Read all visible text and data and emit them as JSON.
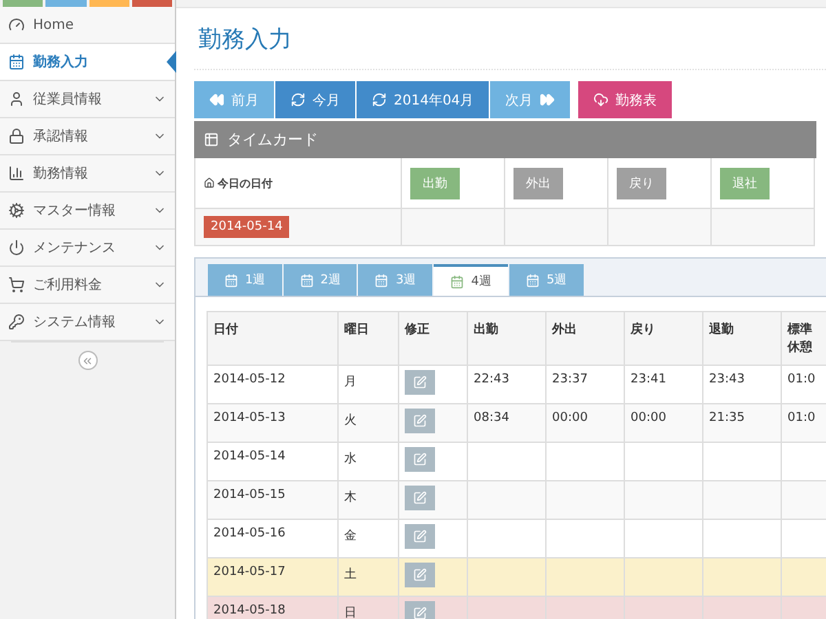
{
  "sidebar": {
    "items": [
      {
        "label": "Home",
        "selected": false,
        "has_submenu": false
      },
      {
        "label": "勤務入力",
        "selected": true,
        "has_submenu": false
      },
      {
        "label": "従業員情報",
        "selected": false,
        "has_submenu": true
      },
      {
        "label": "承認情報",
        "selected": false,
        "has_submenu": true
      },
      {
        "label": "勤務情報",
        "selected": false,
        "has_submenu": true
      },
      {
        "label": "マスター情報",
        "selected": false,
        "has_submenu": true
      },
      {
        "label": "メンテナンス",
        "selected": false,
        "has_submenu": true
      },
      {
        "label": "ご利用料金",
        "selected": false,
        "has_submenu": true
      },
      {
        "label": "システム情報",
        "selected": false,
        "has_submenu": true
      }
    ]
  },
  "page_title": "勤務入力",
  "nav_buttons": [
    {
      "label": "前月",
      "color": "#6fb3e0"
    },
    {
      "label": "今月",
      "color": "#428bca"
    },
    {
      "label": "2014年04月",
      "color": "#428bca"
    },
    {
      "label": "次月",
      "color": "#6fb3e0"
    },
    {
      "label": "勤務表",
      "color": "#d6487e"
    }
  ],
  "timecard": {
    "title": "タイムカード",
    "date_label": "今日の日付",
    "date": "2014-05-14",
    "actions": [
      {
        "label": "出勤",
        "color": "#87b87f"
      },
      {
        "label": "外出",
        "color": "#a0a0a0"
      },
      {
        "label": "戻り",
        "color": "#a0a0a0"
      },
      {
        "label": "退社",
        "color": "#87b87f"
      }
    ]
  },
  "week_tabs": [
    {
      "label": "1週",
      "selected": false
    },
    {
      "label": "2週",
      "selected": false
    },
    {
      "label": "3週",
      "selected": false
    },
    {
      "label": "4週",
      "selected": true
    },
    {
      "label": "5週",
      "selected": false
    }
  ],
  "attendance_table": {
    "columns": [
      "日付",
      "曜日",
      "修正",
      "出勤",
      "外出",
      "戻り",
      "退勤",
      "標準休憩"
    ],
    "rows": [
      {
        "kind": "weekday",
        "date": "2014-05-12",
        "day": "月",
        "times": [
          "22:43",
          "23:37",
          "23:41",
          "23:43",
          "01:0"
        ]
      },
      {
        "kind": "weekday",
        "date": "2014-05-13",
        "day": "火",
        "times": [
          "08:34",
          "00:00",
          "00:00",
          "21:35",
          "01:0"
        ]
      },
      {
        "kind": "weekday",
        "date": "2014-05-14",
        "day": "水",
        "times": []
      },
      {
        "kind": "weekday",
        "date": "2014-05-15",
        "day": "木",
        "times": []
      },
      {
        "kind": "weekday",
        "date": "2014-05-16",
        "day": "金",
        "times": []
      },
      {
        "kind": "saturday",
        "date": "2014-05-17",
        "day": "土",
        "times": []
      },
      {
        "kind": "sunday",
        "date": "2014-05-18",
        "day": "日",
        "times": []
      }
    ]
  }
}
